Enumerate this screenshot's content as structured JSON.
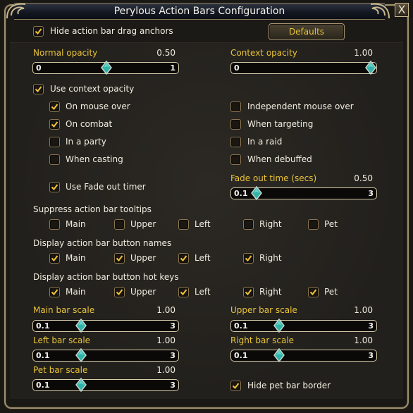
{
  "window": {
    "title": "Perylous Action Bars Configuration",
    "close_label": "X"
  },
  "colors": {
    "accent_gold": "#e8c33a",
    "text": "#f0ece0",
    "thumb": "#2fb3a8",
    "frame": "#9c8f6e"
  },
  "top": {
    "hide_anchors": {
      "label": "Hide action bar drag anchors",
      "checked": true
    },
    "defaults_label": "Defaults"
  },
  "sliders": {
    "normal_opacity": {
      "label": "Normal opacity",
      "value": "0.50",
      "min": "0",
      "max": "1",
      "fraction": 0.5
    },
    "context_opacity": {
      "label": "Context opacity",
      "value": "1.00",
      "min": "0",
      "max": "1",
      "fraction": 1.0
    },
    "fade_out_time": {
      "label": "Fade out time (secs)",
      "value": "0.50",
      "min": "0.1",
      "max": "3",
      "fraction": 0.138
    },
    "main_bar_scale": {
      "label": "Main bar scale",
      "value": "1.00",
      "min": "0.1",
      "max": "3",
      "fraction": 0.31
    },
    "upper_bar_scale": {
      "label": "Upper bar scale",
      "value": "1.00",
      "min": "0.1",
      "max": "3",
      "fraction": 0.31
    },
    "left_bar_scale": {
      "label": "Left bar scale",
      "value": "1.00",
      "min": "0.1",
      "max": "3",
      "fraction": 0.31
    },
    "right_bar_scale": {
      "label": "Right bar scale",
      "value": "1.00",
      "min": "0.1",
      "max": "3",
      "fraction": 0.31
    },
    "pet_bar_scale": {
      "label": "Pet bar scale",
      "value": "1.00",
      "min": "0.1",
      "max": "3",
      "fraction": 0.31
    }
  },
  "context": {
    "use_context_opacity": {
      "label": "Use context opacity",
      "checked": true
    },
    "on_mouse_over": {
      "label": "On mouse over",
      "checked": true
    },
    "on_combat": {
      "label": "On combat",
      "checked": true
    },
    "in_a_party": {
      "label": "In a party",
      "checked": false
    },
    "when_casting": {
      "label": "When casting",
      "checked": false
    },
    "independent_mouse_over": {
      "label": "Independent mouse over",
      "checked": false
    },
    "when_targeting": {
      "label": "When targeting",
      "checked": false
    },
    "in_a_raid": {
      "label": "In a raid",
      "checked": false
    },
    "when_debuffed": {
      "label": "When debuffed",
      "checked": false
    },
    "use_fade_out_timer": {
      "label": "Use Fade out timer",
      "checked": true
    }
  },
  "groups": {
    "suppress_tooltips": {
      "label": "Suppress action bar tooltips",
      "items": [
        {
          "label": "Main",
          "checked": false
        },
        {
          "label": "Upper",
          "checked": false
        },
        {
          "label": "Left",
          "checked": false
        },
        {
          "label": "Right",
          "checked": false
        },
        {
          "label": "Pet",
          "checked": false
        }
      ]
    },
    "button_names": {
      "label": "Display action bar button names",
      "items": [
        {
          "label": "Main",
          "checked": true
        },
        {
          "label": "Upper",
          "checked": true
        },
        {
          "label": "Left",
          "checked": true
        },
        {
          "label": "Right",
          "checked": true
        }
      ]
    },
    "hot_keys": {
      "label": "Display action bar button hot keys",
      "items": [
        {
          "label": "Main",
          "checked": true
        },
        {
          "label": "Upper",
          "checked": true
        },
        {
          "label": "Left",
          "checked": true
        },
        {
          "label": "Right",
          "checked": true
        },
        {
          "label": "Pet",
          "checked": true
        }
      ]
    }
  },
  "bottom": {
    "hide_pet_bar_border": {
      "label": "Hide pet bar border",
      "checked": true
    }
  }
}
